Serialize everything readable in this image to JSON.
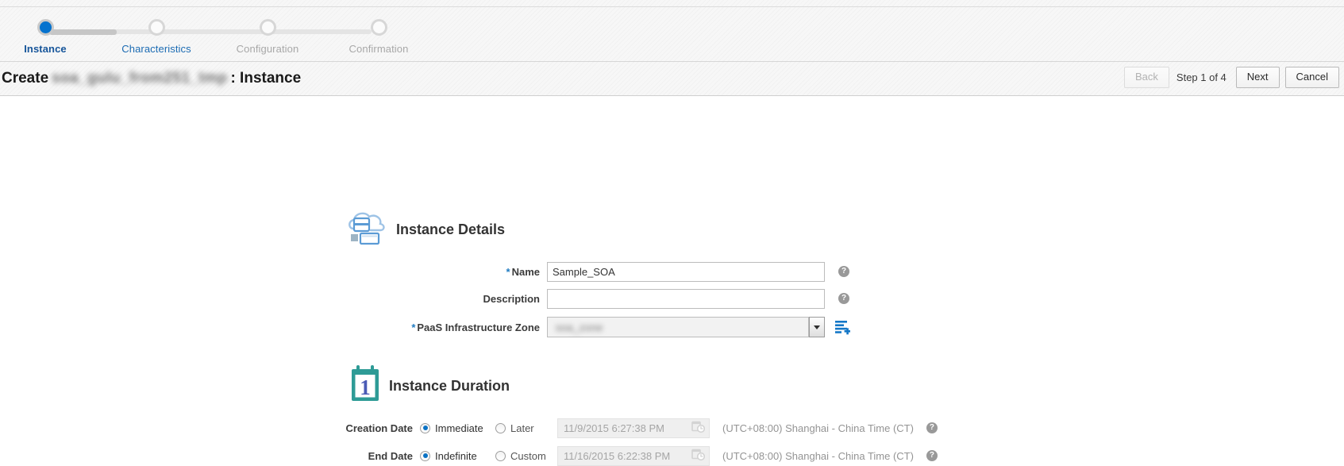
{
  "train": {
    "steps": [
      {
        "label": "Instance",
        "state": "active"
      },
      {
        "label": "Characteristics",
        "state": "visited"
      },
      {
        "label": "Configuration",
        "state": "disabled"
      },
      {
        "label": "Confirmation",
        "state": "disabled"
      }
    ]
  },
  "header": {
    "title_prefix": "Create",
    "title_redacted": "soa_gulu_from251_tmp",
    "title_suffix": ": Instance",
    "back_label": "Back",
    "step_count": "Step 1 of 4",
    "next_label": "Next",
    "cancel_label": "Cancel"
  },
  "instance_details": {
    "section_title": "Instance Details",
    "section_icon": "cloud-server-icon",
    "name": {
      "label": "Name",
      "required": "*",
      "value": "Sample_SOA",
      "help_icon": "help-icon"
    },
    "description": {
      "label": "Description",
      "value": "",
      "placeholder": "",
      "help_icon": "help-icon"
    },
    "zone": {
      "label": "PaaS Infrastructure Zone",
      "required": "*",
      "value_redacted": "soa_zone",
      "dropdown_icon": "chevron-down-icon",
      "create_icon": "create-zone-icon"
    }
  },
  "instance_duration": {
    "section_title": "Instance Duration",
    "section_icon": "calendar-one-icon",
    "creation_date": {
      "label": "Creation Date",
      "option_immediate": "Immediate",
      "option_later": "Later",
      "selected": "Immediate",
      "date_value": "11/9/2015 6:27:38 PM",
      "calendar_icon": "calendar-clock-icon",
      "timezone": "(UTC+08:00) Shanghai - China Time (CT)",
      "help_icon": "help-icon"
    },
    "end_date": {
      "label": "End Date",
      "option_indefinite": "Indefinite",
      "option_custom": "Custom",
      "selected": "Indefinite",
      "date_value": "11/16/2015 6:22:38 PM",
      "calendar_icon": "calendar-clock-icon",
      "timezone": "(UTC+08:00) Shanghai - China Time (CT)",
      "help_icon": "help-icon"
    }
  },
  "colors": {
    "accent_blue": "#0572ce",
    "link_blue": "#16559a",
    "required_star": "#1f7bc1",
    "teal_icon": "#2e9b96",
    "muted_text": "#a8a8a8"
  }
}
